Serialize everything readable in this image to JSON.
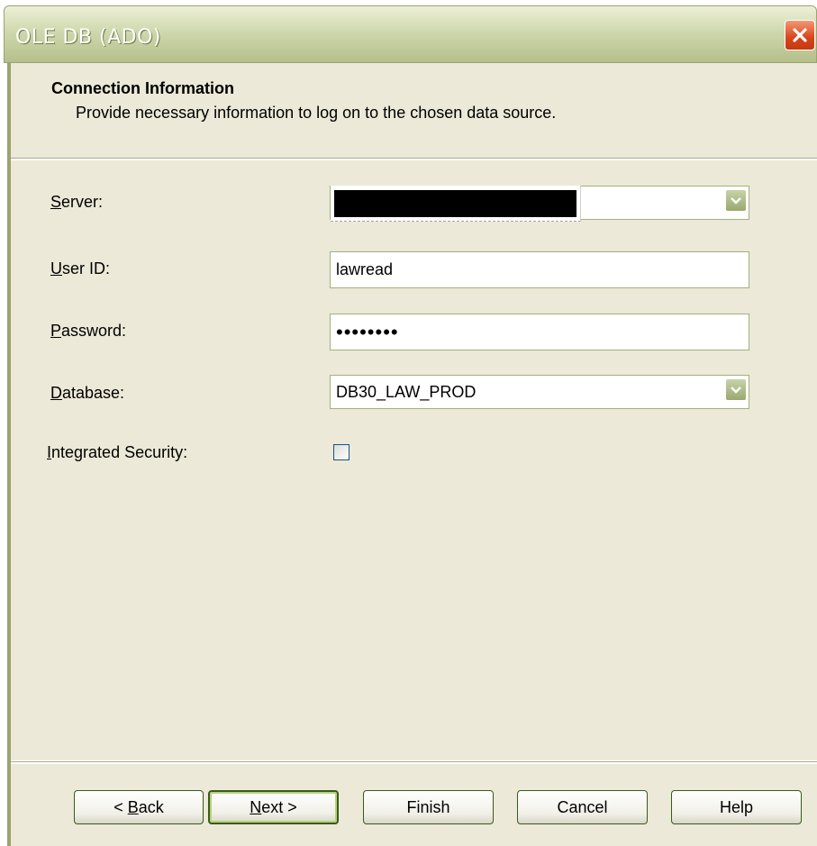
{
  "window": {
    "title": "OLE DB (ADO)",
    "close_icon": "close-x-icon"
  },
  "header": {
    "title": "Connection Information",
    "subtitle": "Provide necessary information to log on to the chosen data source."
  },
  "form": {
    "server": {
      "label_key": "S",
      "label_rest": "erver:",
      "value": ""
    },
    "user_id": {
      "label_key": "U",
      "label_rest": "ser ID:",
      "value": "lawread"
    },
    "password": {
      "label_key": "P",
      "label_rest": "assword:",
      "value": "••••••••"
    },
    "database": {
      "label_key": "D",
      "label_rest": "atabase:",
      "value": "DB30_LAW_PROD"
    },
    "integrated_security": {
      "label_key": "I",
      "label_rest": "ntegrated Security:",
      "checked": false
    }
  },
  "buttons": {
    "back": {
      "prefix": "< ",
      "key": "B",
      "rest": "ack"
    },
    "next": {
      "prefix": "",
      "key": "N",
      "rest": "ext >"
    },
    "finish": "Finish",
    "cancel": "Cancel",
    "help": "Help"
  },
  "colors": {
    "titlebar": "#cfd8ad",
    "face": "#ece9d8",
    "close": "#d9441b"
  }
}
